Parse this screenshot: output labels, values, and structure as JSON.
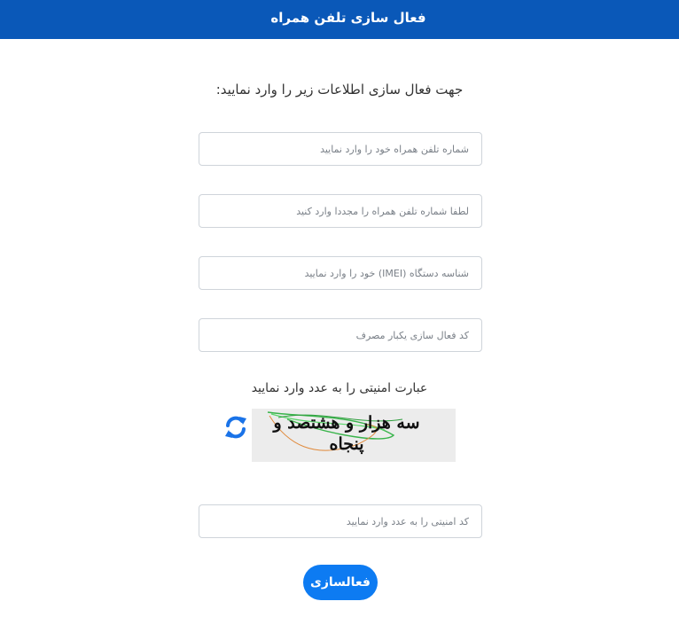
{
  "header": {
    "title": "فعال سازی تلفن همراه"
  },
  "intro": {
    "text": "جهت فعال سازی اطلاعات زیر را وارد نمایید:"
  },
  "form": {
    "phone_placeholder": "شماره تلفن همراه خود را وارد نمایید",
    "phone_confirm_placeholder": "لطفا شماره تلفن همراه را مجددا وارد کنید",
    "imei_placeholder": "شناسه دستگاه (IMEI) خود را وارد نمایید",
    "otp_placeholder": "کد فعال سازی یکبار مصرف",
    "captcha_title": "عبارت امنیتی را به عدد وارد نمایید",
    "captcha_image_text": "سه هزار و هشتصد و پنجاه",
    "captcha_placeholder": "کد امنیتی را به عدد وارد نمایید",
    "submit_label": "فعالسازی"
  },
  "colors": {
    "header_bg": "#0a58b8",
    "accent": "#0d7bf2",
    "refresh_icon": "#1a73e8"
  },
  "icons": {
    "refresh": "refresh-icon"
  }
}
